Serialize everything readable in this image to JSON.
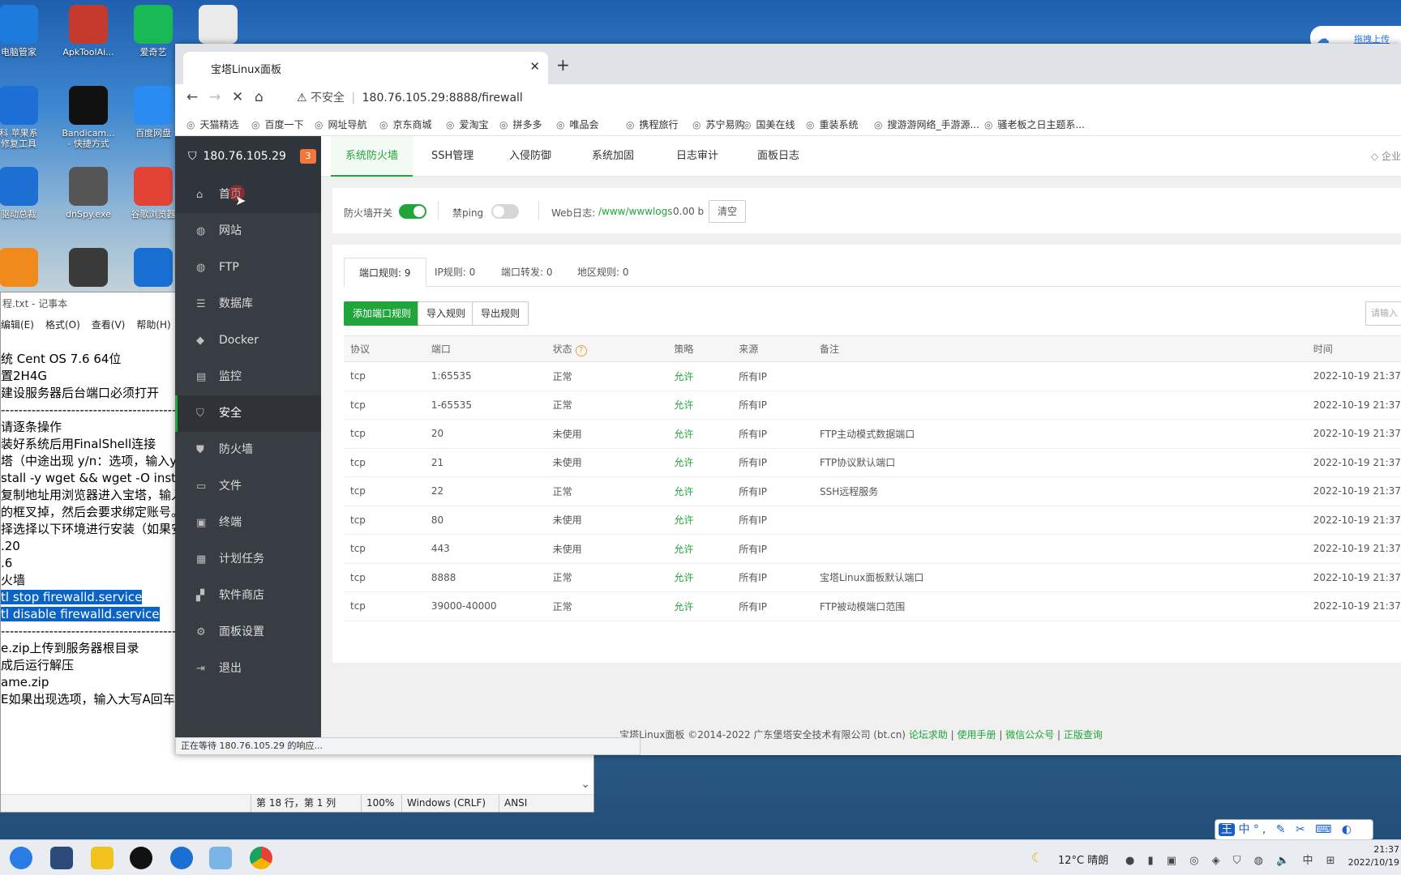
{
  "desktop": {
    "icons": [
      {
        "label": "电脑管家",
        "color": "#1d7bdc"
      },
      {
        "label": "ApkToolAi...",
        "color": "#c43b2d"
      },
      {
        "label": "爱奇艺",
        "color": "#19b955"
      },
      {
        "label": "",
        "color": "#eaeaea"
      },
      {
        "label": "科 苹果系\n修复工具",
        "color": "#1d6fd6"
      },
      {
        "label": "Bandicam...\n- 快捷方式",
        "color": "#111111"
      },
      {
        "label": "百度网盘",
        "color": "#2a8cf0"
      },
      {
        "label": "驱动总裁",
        "color": "#1c70d4"
      },
      {
        "label": "dnSpy.exe",
        "color": "#555555"
      },
      {
        "label": "谷歌浏览器",
        "color": "#e24335"
      },
      {
        "label": "",
        "color": "#f08a1c"
      },
      {
        "label": "",
        "color": "#3a3a3a"
      },
      {
        "label": "",
        "color": "#1a6fd2"
      }
    ],
    "upload_label": "拖拽上传"
  },
  "notepad": {
    "title": "程.txt - 记事本",
    "menu": [
      "编辑(E)",
      "格式(O)",
      "查看(V)",
      "帮助(H)"
    ],
    "lines": [
      "统 Cent OS 7.6 64位",
      "置2H4G",
      "建设服务器后台端口必须打开",
      "----------------------------------------------------------------",
      "请逐条操作",
      "装好系统后用FinalShell连接",
      "塔（中途出现 y/n：选项，输入y",
      "stall -y wget && wget -O inst",
      "复制地址用浏览器进入宝塔，输入",
      "的框叉掉，然后会要求绑定账号。",
      "择选择以下环境进行安装（如果安",
      ".20",
      ".6",
      "",
      "",
      "火墙"
    ],
    "selected_lines": [
      "tl stop firewalld.service",
      "tl disable firewalld.service"
    ],
    "lines_after": [
      "----------------------------------------------------------------",
      "e.zip上传到服务器根目录",
      "成后运行解压",
      "",
      "ame.zip",
      "E如果出现选项，输入大写A回车"
    ],
    "status": {
      "position": "第 18 行，第 1 列",
      "zoom": "100%",
      "eol": "Windows (CRLF)",
      "encoding": "ANSI"
    }
  },
  "browser": {
    "tab_title": "宝塔Linux面板",
    "url_warning": "不安全",
    "url": "180.76.105.29:8888/firewall",
    "bookmarks": [
      "天猫精选",
      "百度一下",
      "网址导航",
      "京东商城",
      "爱淘宝",
      "拼多多",
      "唯品会",
      "携程旅行",
      "苏宁易购",
      "国美在线",
      "重装系统",
      "搜游游网络_手游源...",
      "骚老板之日主题系..."
    ],
    "status_text": "正在等待 180.76.105.29 的响应..."
  },
  "panel": {
    "host": "180.76.105.29",
    "badge": "3",
    "nav": [
      {
        "label": "首页",
        "icon": "⌂"
      },
      {
        "label": "网站",
        "icon": "◍"
      },
      {
        "label": "FTP",
        "icon": "◍"
      },
      {
        "label": "数据库",
        "icon": "☰"
      },
      {
        "label": "Docker",
        "icon": "◆"
      },
      {
        "label": "监控",
        "icon": "▤"
      },
      {
        "label": "安全",
        "icon": "⛉"
      },
      {
        "label": "防火墙",
        "icon": "⛊"
      },
      {
        "label": "文件",
        "icon": "▭"
      },
      {
        "label": "终端",
        "icon": "▣"
      },
      {
        "label": "计划任务",
        "icon": "▦"
      },
      {
        "label": "软件商店",
        "icon": "▞"
      },
      {
        "label": "面板设置",
        "icon": "⚙"
      },
      {
        "label": "退出",
        "icon": "⇥"
      }
    ],
    "top_tabs": [
      "系统防火墙",
      "SSH管理",
      "入侵防御",
      "系统加固",
      "日志审计",
      "面板日志"
    ],
    "enterprise_label": "企业",
    "firewall_switch_label": "防火墙开关",
    "ping_label": "禁ping",
    "weblog_label": "Web日志:",
    "weblog_path": "/www/wwwlogs",
    "weblog_size": "0.00 b",
    "clear_button": "清空",
    "rule_tabs": [
      {
        "label": "端口规则",
        "count": "9"
      },
      {
        "label": "IP规则",
        "count": "0"
      },
      {
        "label": "端口转发",
        "count": "0"
      },
      {
        "label": "地区规则",
        "count": "0"
      }
    ],
    "buttons": {
      "add": "添加端口规则",
      "import": "导入规则",
      "export": "导出规则"
    },
    "search_placeholder": "请输入",
    "table": {
      "headers": [
        "协议",
        "端口",
        "状态",
        "策略",
        "来源",
        "备注",
        "时间"
      ],
      "rows": [
        [
          "tcp",
          "1:65535",
          "正常",
          "允许",
          "所有IP",
          "",
          "2022-10-19 21:37"
        ],
        [
          "tcp",
          "1-65535",
          "正常",
          "允许",
          "所有IP",
          "",
          "2022-10-19 21:37"
        ],
        [
          "tcp",
          "20",
          "未使用",
          "允许",
          "所有IP",
          "FTP主动模式数据端口",
          "2022-10-19 21:37"
        ],
        [
          "tcp",
          "21",
          "未使用",
          "允许",
          "所有IP",
          "FTP协议默认端口",
          "2022-10-19 21:37"
        ],
        [
          "tcp",
          "22",
          "正常",
          "允许",
          "所有IP",
          "SSH远程服务",
          "2022-10-19 21:37"
        ],
        [
          "tcp",
          "80",
          "未使用",
          "允许",
          "所有IP",
          "",
          "2022-10-19 21:37"
        ],
        [
          "tcp",
          "443",
          "未使用",
          "允许",
          "所有IP",
          "",
          "2022-10-19 21:37"
        ],
        [
          "tcp",
          "8888",
          "正常",
          "允许",
          "所有IP",
          "宝塔Linux面板默认端口",
          "2022-10-19 21:37"
        ],
        [
          "tcp",
          "39000-40000",
          "正常",
          "允许",
          "所有IP",
          "FTP被动模端口范围",
          "2022-10-19 21:37"
        ]
      ]
    },
    "footer": {
      "copyright": "宝塔Linux面板 ©2014-2022 广东堡塔安全技术有限公司 (bt.cn)",
      "links": [
        "论坛求助",
        "使用手册",
        "微信公众号",
        "正版查询"
      ]
    }
  },
  "taskbar": {
    "weather": "12°C 晴朗",
    "time": "21:37",
    "date": "2022/10/19",
    "ime": "中"
  }
}
